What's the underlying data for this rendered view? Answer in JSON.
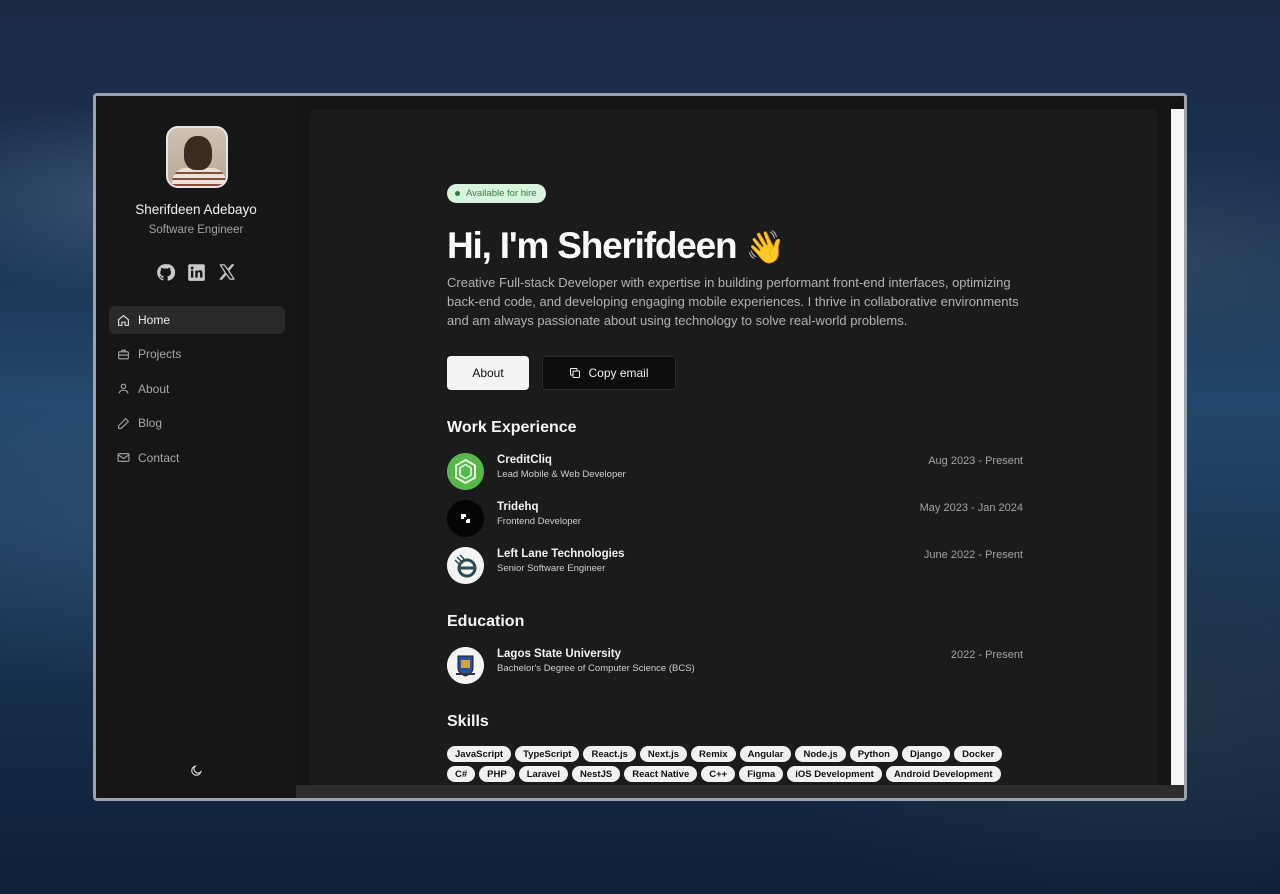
{
  "profile": {
    "name": "Sherifdeen Adebayo",
    "role": "Software Engineer"
  },
  "socials": [
    "github-icon",
    "linkedin-icon",
    "x-icon"
  ],
  "nav": {
    "items": [
      {
        "label": "Home",
        "icon": "home-icon",
        "active": true
      },
      {
        "label": "Projects",
        "icon": "briefcase-icon"
      },
      {
        "label": "About",
        "icon": "user-icon"
      },
      {
        "label": "Blog",
        "icon": "pen-icon"
      },
      {
        "label": "Contact",
        "icon": "mail-icon"
      }
    ]
  },
  "hero": {
    "badge": "Available for hire",
    "title": "Hi, I'm Sherifdeen",
    "emoji": "👋",
    "description": "Creative Full-stack Developer with expertise in building performant front-end interfaces, optimizing back-end code, and developing engaging mobile experiences. I thrive in collaborative environments and am always passionate about using technology to solve real-world problems.",
    "about_button": "About",
    "copy_button": "Copy email"
  },
  "work": {
    "title": "Work Experience",
    "items": [
      {
        "company": "CreditCliq",
        "role": "Lead Mobile & Web Developer",
        "date": "Aug 2023 - Present"
      },
      {
        "company": "Tridehq",
        "role": "Frontend Developer",
        "date": "May 2023 - Jan 2024"
      },
      {
        "company": "Left Lane Technologies",
        "role": "Senior Software Engineer",
        "date": "June 2022 - Present"
      }
    ]
  },
  "education": {
    "title": "Education",
    "items": [
      {
        "school": "Lagos State University",
        "degree": "Bachelor's Degree of Computer Science (BCS)",
        "date": "2022 - Present"
      }
    ]
  },
  "skills": {
    "title": "Skills",
    "row1": [
      "JavaScript",
      "TypeScript",
      "React.js",
      "Next.js",
      "Remix",
      "Angular",
      "Node.js",
      "Python",
      "Django",
      "Docker"
    ],
    "row2": [
      "C#",
      "PHP",
      "Laravel",
      "NestJS",
      "React Native",
      "C++",
      "Figma",
      "iOS Development",
      "Android Development"
    ]
  },
  "colors": {
    "badge_bg": "#d9f4dc",
    "badge_text": "#2f7d3f",
    "page_bg": "#1b1b1b",
    "sidebar_bg": "#161616"
  }
}
